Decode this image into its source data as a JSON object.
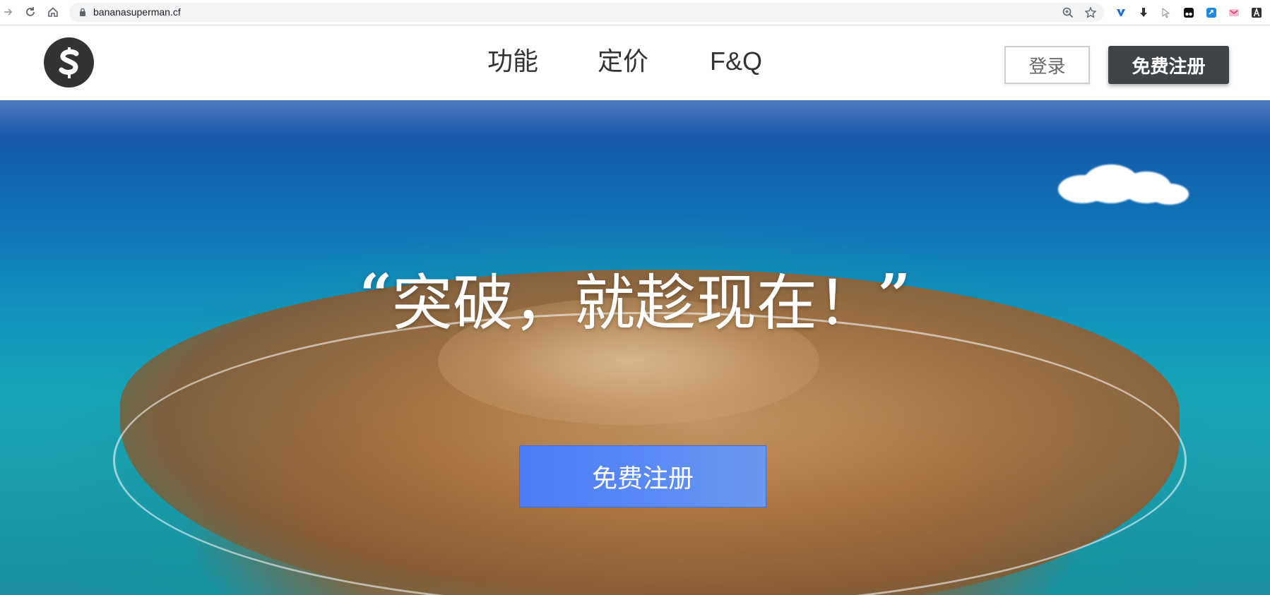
{
  "browser": {
    "url": "bananasuperman.cf",
    "icons": {
      "forward": "forward-arrow-icon",
      "reload": "reload-icon",
      "home": "home-icon",
      "lock": "lock-icon",
      "zoom": "zoom-icon",
      "bookmark": "star-icon"
    },
    "extensions": [
      {
        "name": "vpn-extension-icon",
        "color": "#1a6fd8"
      },
      {
        "name": "download-extension-icon",
        "color": "#333333"
      },
      {
        "name": "cursor-extension-icon",
        "color": "#9e9e9e"
      },
      {
        "name": "tampermonkey-extension-icon",
        "color": "#111111"
      },
      {
        "name": "sync-extension-icon",
        "color": "#1e88e5"
      },
      {
        "name": "pink-extension-icon",
        "color": "#f48fb1"
      },
      {
        "name": "font-extension-icon",
        "color": "#333333"
      }
    ]
  },
  "header": {
    "logo_letter": "S",
    "nav": {
      "features": "功能",
      "pricing": "定价",
      "faq": "F&Q"
    },
    "login_label": "登录",
    "signup_label": "免费注册"
  },
  "hero": {
    "quote_open": "“",
    "headline": "突破，就趁现在！",
    "quote_close": "”",
    "cta_label": "免费注册"
  },
  "colors": {
    "signup_button_bg": "#3f4449",
    "cta_bg": "#5a8af5",
    "logo_bg": "#333333",
    "nav_text": "#333333"
  }
}
